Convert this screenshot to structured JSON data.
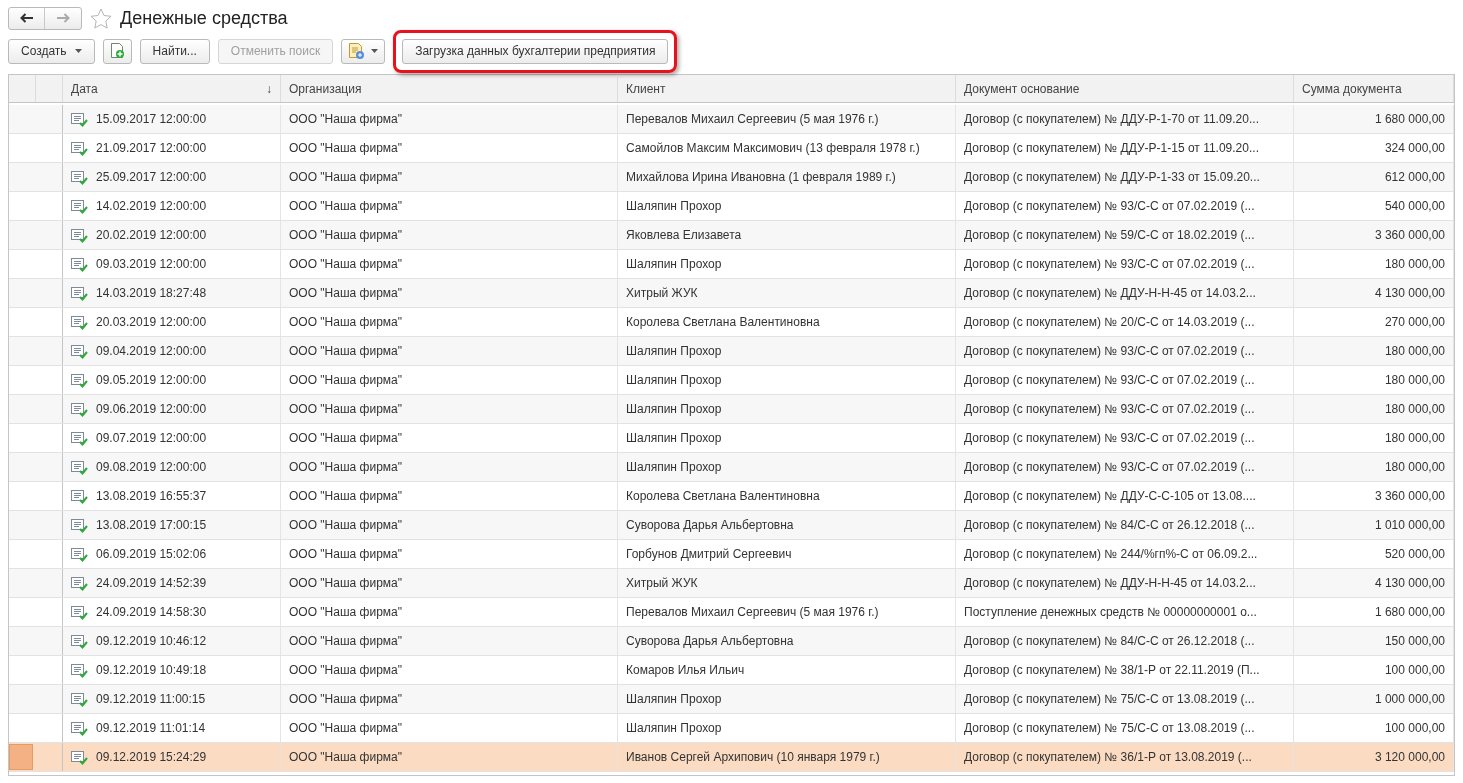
{
  "window": {
    "title": "Денежные средства",
    "favorite": false
  },
  "toolbar": {
    "buttons": [
      {
        "kind": "dropdown",
        "label": "Создать",
        "disabled": false
      },
      {
        "kind": "add-icon",
        "disabled": false
      },
      {
        "kind": "text",
        "label": "Найти...",
        "disabled": false
      },
      {
        "kind": "text",
        "label": "Отменить поиск",
        "disabled": true
      },
      {
        "kind": "icon-dropdown",
        "disabled": false
      },
      {
        "kind": "text",
        "label": "Загрузка данных бухгалтерии предприятия",
        "disabled": false,
        "highlighted": true
      }
    ]
  },
  "table": {
    "columns": [
      {
        "label": "Дата",
        "sort": "↓"
      },
      {
        "label": "Организация"
      },
      {
        "label": "Клиент"
      },
      {
        "label": "Документ основание"
      },
      {
        "label": "Сумма документа"
      }
    ],
    "rows": [
      {
        "date": "15.09.2017 12:00:00",
        "org": "ООО \"Наша фирма\"",
        "client": "Перевалов Михаил Сергеевич (5 мая 1976 г.)",
        "doc": "Договор (с покупателем) № ДДУ-Р-1-70 от 11.09.20...",
        "sum": "1 680 000,00",
        "selected": false
      },
      {
        "date": "21.09.2017 12:00:00",
        "org": "ООО \"Наша фирма\"",
        "client": "Самойлов Максим Максимович (13 февраля 1978 г.)",
        "doc": "Договор (с покупателем) № ДДУ-Р-1-15 от 11.09.20...",
        "sum": "324 000,00",
        "selected": false
      },
      {
        "date": "25.09.2017 12:00:00",
        "org": "ООО \"Наша фирма\"",
        "client": "Михайлова Ирина Ивановна (1 февраля 1989 г.)",
        "doc": "Договор (с покупателем) № ДДУ-Р-1-33 от 15.09.20...",
        "sum": "612 000,00",
        "selected": false
      },
      {
        "date": "14.02.2019 12:00:00",
        "org": "ООО \"Наша фирма\"",
        "client": "Шаляпин Прохор",
        "doc": "Договор (с покупателем) № 93/С-С от 07.02.2019 (...",
        "sum": "540 000,00",
        "selected": false
      },
      {
        "date": "20.02.2019 12:00:00",
        "org": "ООО \"Наша фирма\"",
        "client": "Яковлева Елизавета",
        "doc": "Договор (с покупателем) № 59/С-С от 18.02.2019 (...",
        "sum": "3 360 000,00",
        "selected": false
      },
      {
        "date": "09.03.2019 12:00:00",
        "org": "ООО \"Наша фирма\"",
        "client": "Шаляпин Прохор",
        "doc": "Договор (с покупателем) № 93/С-С от 07.02.2019 (...",
        "sum": "180 000,00",
        "selected": false
      },
      {
        "date": "14.03.2019 18:27:48",
        "org": "ООО \"Наша фирма\"",
        "client": "Хитрый ЖУК",
        "doc": "Договор (с покупателем) № ДДУ-Н-Н-45 от 14.03.2...",
        "sum": "4 130 000,00",
        "selected": false
      },
      {
        "date": "20.03.2019 12:00:00",
        "org": "ООО \"Наша фирма\"",
        "client": "Королева Светлана Валентиновна",
        "doc": "Договор (с покупателем) № 20/С-С от 14.03.2019 (...",
        "sum": "270 000,00",
        "selected": false
      },
      {
        "date": "09.04.2019 12:00:00",
        "org": "ООО \"Наша фирма\"",
        "client": "Шаляпин Прохор",
        "doc": "Договор (с покупателем) № 93/С-С от 07.02.2019 (...",
        "sum": "180 000,00",
        "selected": false
      },
      {
        "date": "09.05.2019 12:00:00",
        "org": "ООО \"Наша фирма\"",
        "client": "Шаляпин Прохор",
        "doc": "Договор (с покупателем) № 93/С-С от 07.02.2019 (...",
        "sum": "180 000,00",
        "selected": false
      },
      {
        "date": "09.06.2019 12:00:00",
        "org": "ООО \"Наша фирма\"",
        "client": "Шаляпин Прохор",
        "doc": "Договор (с покупателем) № 93/С-С от 07.02.2019 (...",
        "sum": "180 000,00",
        "selected": false
      },
      {
        "date": "09.07.2019 12:00:00",
        "org": "ООО \"Наша фирма\"",
        "client": "Шаляпин Прохор",
        "doc": "Договор (с покупателем) № 93/С-С от 07.02.2019 (...",
        "sum": "180 000,00",
        "selected": false
      },
      {
        "date": "09.08.2019 12:00:00",
        "org": "ООО \"Наша фирма\"",
        "client": "Шаляпин Прохор",
        "doc": "Договор (с покупателем) № 93/С-С от 07.02.2019 (...",
        "sum": "180 000,00",
        "selected": false
      },
      {
        "date": "13.08.2019 16:55:37",
        "org": "ООО \"Наша фирма\"",
        "client": "Королева Светлана Валентиновна",
        "doc": "Договор (с покупателем) № ДДУ-С-С-105 от 13.08....",
        "sum": "3 360 000,00",
        "selected": false
      },
      {
        "date": "13.08.2019 17:00:15",
        "org": "ООО \"Наша фирма\"",
        "client": "Суворова Дарья Альбертовна",
        "doc": "Договор (с покупателем) № 84/С-С от 26.12.2018 (...",
        "sum": "1 010 000,00",
        "selected": false
      },
      {
        "date": "06.09.2019 15:02:06",
        "org": "ООО \"Наша фирма\"",
        "client": "Горбунов Дмитрий Сергеевич",
        "doc": "Договор (с покупателем) № 244/%гп%-С от 06.09.2...",
        "sum": "520 000,00",
        "selected": false
      },
      {
        "date": "24.09.2019 14:52:39",
        "org": "ООО \"Наша фирма\"",
        "client": "Хитрый ЖУК",
        "doc": "Договор (с покупателем) № ДДУ-Н-Н-45 от 14.03.2...",
        "sum": "4 130 000,00",
        "selected": false
      },
      {
        "date": "24.09.2019 14:58:30",
        "org": "ООО \"Наша фирма\"",
        "client": "Перевалов Михаил Сергеевич (5 мая 1976 г.)",
        "doc": "Поступление денежных средств № 00000000001 о...",
        "sum": "1 680 000,00",
        "selected": false
      },
      {
        "date": "09.12.2019 10:46:12",
        "org": "ООО \"Наша фирма\"",
        "client": "Суворова Дарья Альбертовна",
        "doc": "Договор (с покупателем) № 84/С-С от 26.12.2018 (...",
        "sum": "150 000,00",
        "selected": false
      },
      {
        "date": "09.12.2019 10:49:18",
        "org": "ООО \"Наша фирма\"",
        "client": "Комаров Илья Ильич",
        "doc": "Договор (с покупателем) № 38/1-Р от 22.11.2019 (П...",
        "sum": "100 000,00",
        "selected": false
      },
      {
        "date": "09.12.2019 11:00:15",
        "org": "ООО \"Наша фирма\"",
        "client": "Шаляпин Прохор",
        "doc": "Договор (с покупателем) № 75/С-С от 13.08.2019 (...",
        "sum": "1 000 000,00",
        "selected": false
      },
      {
        "date": "09.12.2019 11:01:14",
        "org": "ООО \"Наша фирма\"",
        "client": "Шаляпин Прохор",
        "doc": "Договор (с покупателем) № 75/С-С от 13.08.2019 (...",
        "sum": "100 000,00",
        "selected": false
      },
      {
        "date": "09.12.2019 15:24:29",
        "org": "ООО \"Наша фирма\"",
        "client": "Иванов Сергей Архипович (10 января 1979 г.)",
        "doc": "Договор (с покупателем) № 36/1-Р от 13.08.2019 (...",
        "sum": "3 120 000,00",
        "selected": true
      }
    ]
  }
}
